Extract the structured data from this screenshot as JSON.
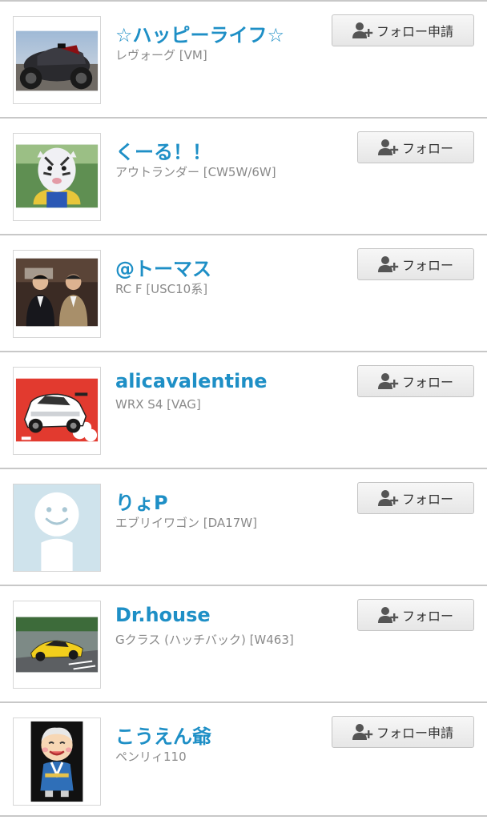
{
  "users": [
    {
      "name": "☆ハッピーライフ☆",
      "car": "レヴォーグ [VM]",
      "button": "フォロー申請"
    },
    {
      "name": "くーる！！",
      "car": "アウトランダー [CW5W/6W]",
      "button": "フォロー"
    },
    {
      "name": "@トーマス",
      "car": "RC F [USC10系]",
      "button": "フォロー"
    },
    {
      "name": "alicavalentine",
      "car": "WRX S4 [VAG]",
      "button": "フォロー"
    },
    {
      "name": "りょP",
      "car": "エブリイワゴン [DA17W]",
      "button": "フォロー"
    },
    {
      "name": "Dr.house",
      "car": "Gクラス (ハッチバック) [W463]",
      "button": "フォロー"
    },
    {
      "name": "こうえん爺",
      "car": "ペンリィ110",
      "button": "フォロー申請"
    }
  ],
  "icons": {
    "follow": "add-user-icon"
  },
  "colors": {
    "name": "#1e8fc6",
    "subtext": "#8a8a8a",
    "divider": "#c8c8c8"
  }
}
